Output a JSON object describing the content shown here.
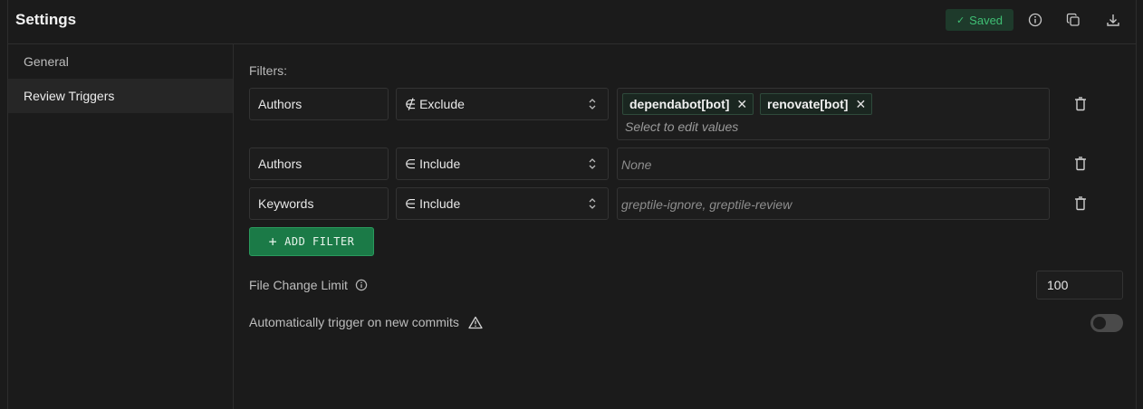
{
  "header": {
    "title": "Settings",
    "saved_check": "✓",
    "saved_label": "Saved",
    "icons": [
      "info-icon",
      "copy-icon",
      "download-icon"
    ]
  },
  "sidebar": {
    "items": [
      {
        "label": "General",
        "active": false
      },
      {
        "label": "Review Triggers",
        "active": true
      }
    ]
  },
  "filters": {
    "label": "Filters:",
    "rows": [
      {
        "field": "Authors",
        "operator": "∉ Exclude",
        "chips": [
          "dependabot[bot]",
          "renovate[bot]"
        ],
        "hint": "Select to edit values"
      },
      {
        "field": "Authors",
        "operator": "∈ Include",
        "placeholder": "None"
      },
      {
        "field": "Keywords",
        "operator": "∈ Include",
        "placeholder": "greptile-ignore, greptile-review"
      }
    ],
    "add_button_label": "ADD FILTER",
    "add_button_icon": "+"
  },
  "file_change_limit": {
    "label": "File Change Limit",
    "value": "100"
  },
  "auto_trigger": {
    "label": "Automatically trigger on new commits",
    "enabled": false
  },
  "colors": {
    "accent": "#1b7a47",
    "saved": "#3fbf74",
    "background": "#1b1b1b"
  }
}
